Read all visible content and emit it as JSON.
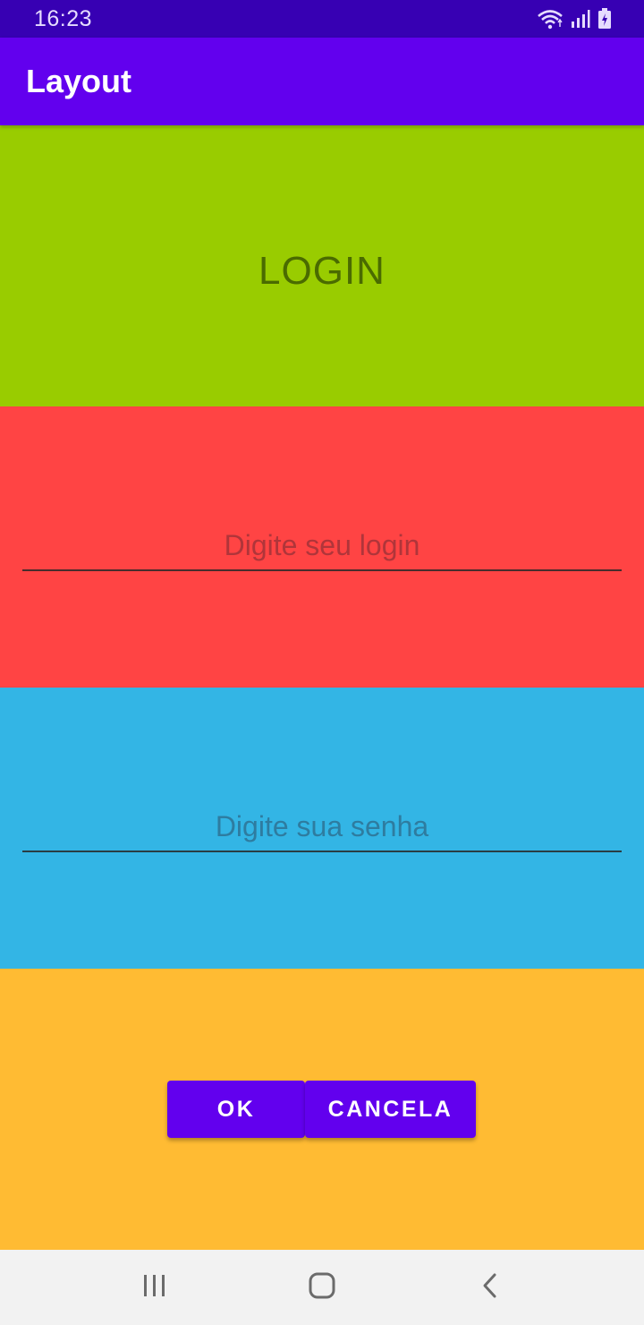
{
  "status_bar": {
    "time": "16:23",
    "icons": [
      "wifi-icon",
      "signal-icon",
      "battery-icon"
    ]
  },
  "app_bar": {
    "title": "Layout"
  },
  "login_section": {
    "heading": "LOGIN",
    "background": "#99cc00"
  },
  "user_section": {
    "placeholder": "Digite seu login",
    "value": "",
    "background": "#ff4444"
  },
  "password_section": {
    "placeholder": "Digite sua senha",
    "value": "",
    "background": "#33b5e5"
  },
  "buttons_section": {
    "ok_label": "OK",
    "cancel_label": "CANCELA",
    "background": "#ffbb33"
  },
  "nav_bar": {
    "icons": [
      "recents-icon",
      "home-icon",
      "back-icon"
    ]
  },
  "colors": {
    "primary": "#6200ee",
    "primary_dark": "#3700b3"
  }
}
